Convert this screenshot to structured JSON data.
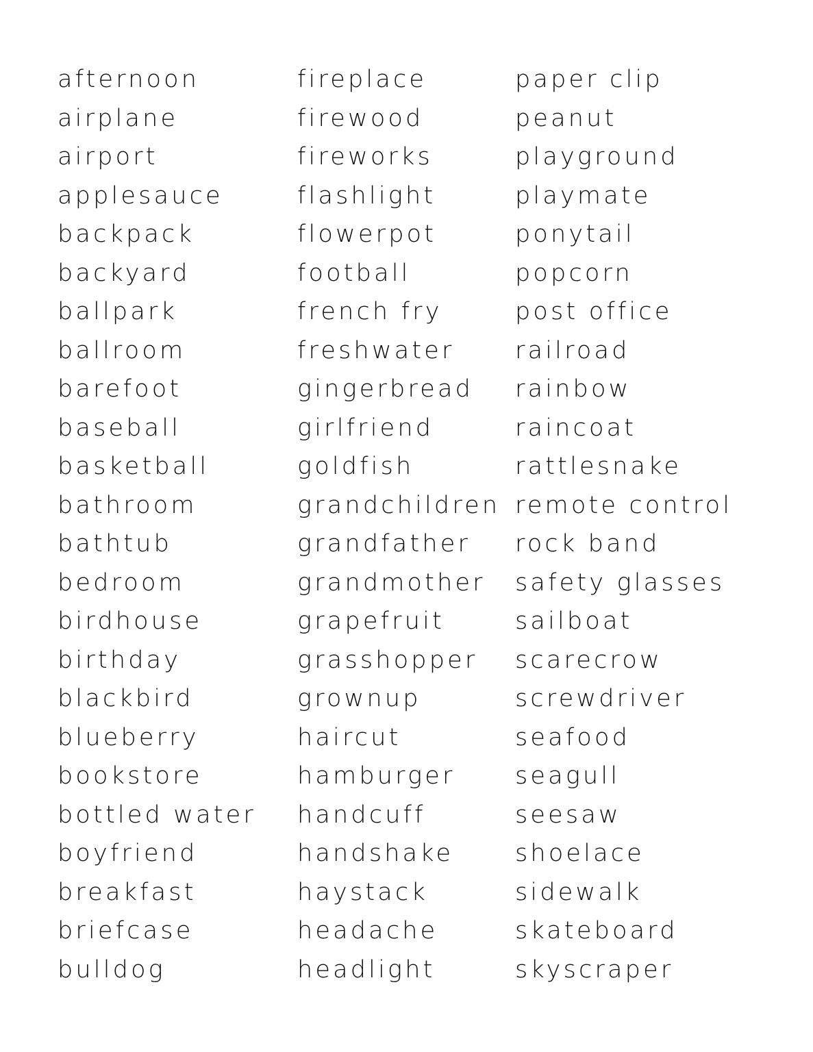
{
  "columns": [
    {
      "words": [
        "afternoon",
        "airplane",
        "airport",
        "applesauce",
        "backpack",
        "backyard",
        "ballpark",
        "ballroom",
        "barefoot",
        "baseball",
        "basketball",
        "bathroom",
        "bathtub",
        "bedroom",
        "birdhouse",
        "birthday",
        "blackbird",
        "blueberry",
        "bookstore",
        "bottled water",
        "boyfriend",
        "breakfast",
        "briefcase",
        "bulldog"
      ]
    },
    {
      "words": [
        "fireplace",
        "firewood",
        "fireworks",
        "flashlight",
        "flowerpot",
        "football",
        "french fry",
        "freshwater",
        "gingerbread",
        "girlfriend",
        "goldfish",
        "grandchildren",
        "grandfather",
        "grandmother",
        "grapefruit",
        "grasshopper",
        "grownup",
        "haircut",
        "hamburger",
        "handcuff",
        "handshake",
        "haystack",
        "headache",
        "headlight"
      ]
    },
    {
      "words": [
        "paper clip",
        "peanut",
        "playground",
        "playmate",
        "ponytail",
        "popcorn",
        "post office",
        "railroad",
        "rainbow",
        "raincoat",
        "rattlesnake",
        "remote control",
        "rock band",
        "safety glasses",
        "sailboat",
        "scarecrow",
        "screwdriver",
        "seafood",
        "seagull",
        "seesaw",
        "shoelace",
        "sidewalk",
        "skateboard",
        "skyscraper"
      ]
    }
  ]
}
